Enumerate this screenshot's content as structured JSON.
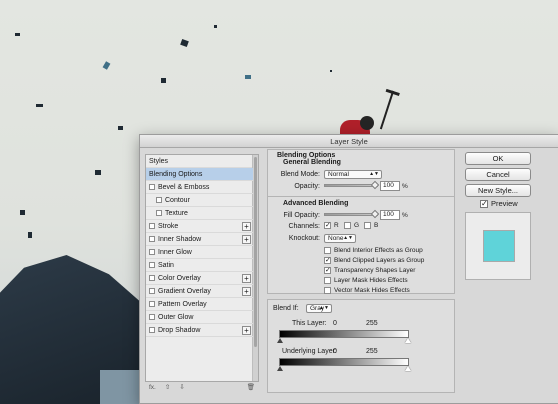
{
  "window": {
    "title": "Layer Style"
  },
  "styles_list": {
    "header": "Styles",
    "items": [
      {
        "label": "Blending Options",
        "checkbox": false,
        "plus": false,
        "selected": true,
        "indent": false
      },
      {
        "label": "Bevel & Emboss",
        "checkbox": true,
        "plus": false,
        "selected": false,
        "indent": false
      },
      {
        "label": "Contour",
        "checkbox": true,
        "plus": false,
        "selected": false,
        "indent": true
      },
      {
        "label": "Texture",
        "checkbox": true,
        "plus": false,
        "selected": false,
        "indent": true
      },
      {
        "label": "Stroke",
        "checkbox": true,
        "plus": true,
        "selected": false,
        "indent": false
      },
      {
        "label": "Inner Shadow",
        "checkbox": true,
        "plus": true,
        "selected": false,
        "indent": false
      },
      {
        "label": "Inner Glow",
        "checkbox": true,
        "plus": false,
        "selected": false,
        "indent": false
      },
      {
        "label": "Satin",
        "checkbox": true,
        "plus": false,
        "selected": false,
        "indent": false
      },
      {
        "label": "Color Overlay",
        "checkbox": true,
        "plus": true,
        "selected": false,
        "indent": false
      },
      {
        "label": "Gradient Overlay",
        "checkbox": true,
        "plus": true,
        "selected": false,
        "indent": false
      },
      {
        "label": "Pattern Overlay",
        "checkbox": true,
        "plus": false,
        "selected": false,
        "indent": false
      },
      {
        "label": "Outer Glow",
        "checkbox": true,
        "plus": false,
        "selected": false,
        "indent": false
      },
      {
        "label": "Drop Shadow",
        "checkbox": true,
        "plus": true,
        "selected": false,
        "indent": false
      }
    ],
    "footer": {
      "fx": "fx.",
      "up": "⇧",
      "down": "⇩",
      "trash": "🗑"
    }
  },
  "blending": {
    "section_title": "Blending Options",
    "general_title": "General Blending",
    "blend_mode_label": "Blend Mode:",
    "blend_mode_value": "Normal",
    "opacity_label": "Opacity:",
    "opacity_value": "100",
    "opacity_unit": "%",
    "advanced_title": "Advanced Blending",
    "fill_opacity_label": "Fill Opacity:",
    "fill_opacity_value": "100",
    "fill_opacity_unit": "%",
    "channels_label": "Channels:",
    "channels": [
      {
        "label": "R",
        "checked": true
      },
      {
        "label": "G",
        "checked": false
      },
      {
        "label": "B",
        "checked": false
      }
    ],
    "knockout_label": "Knockout:",
    "knockout_value": "None",
    "options": [
      {
        "label": "Blend Interior Effects as Group",
        "checked": false
      },
      {
        "label": "Blend Clipped Layers as Group",
        "checked": true
      },
      {
        "label": "Transparency Shapes Layer",
        "checked": true
      },
      {
        "label": "Layer Mask Hides Effects",
        "checked": false
      },
      {
        "label": "Vector Mask Hides Effects",
        "checked": false
      }
    ],
    "blend_if_label": "Blend If:",
    "blend_if_value": "Gray",
    "this_layer_label": "This Layer:",
    "this_layer_min": "0",
    "this_layer_max": "255",
    "underlying_layer_label": "Underlying Layer:",
    "underlying_layer_min": "0",
    "underlying_layer_max": "255"
  },
  "buttons": {
    "ok": "OK",
    "cancel": "Cancel",
    "new_style": "New Style..."
  },
  "preview": {
    "label": "Preview",
    "checked": true,
    "swatch_color": "#5fd3d9"
  }
}
